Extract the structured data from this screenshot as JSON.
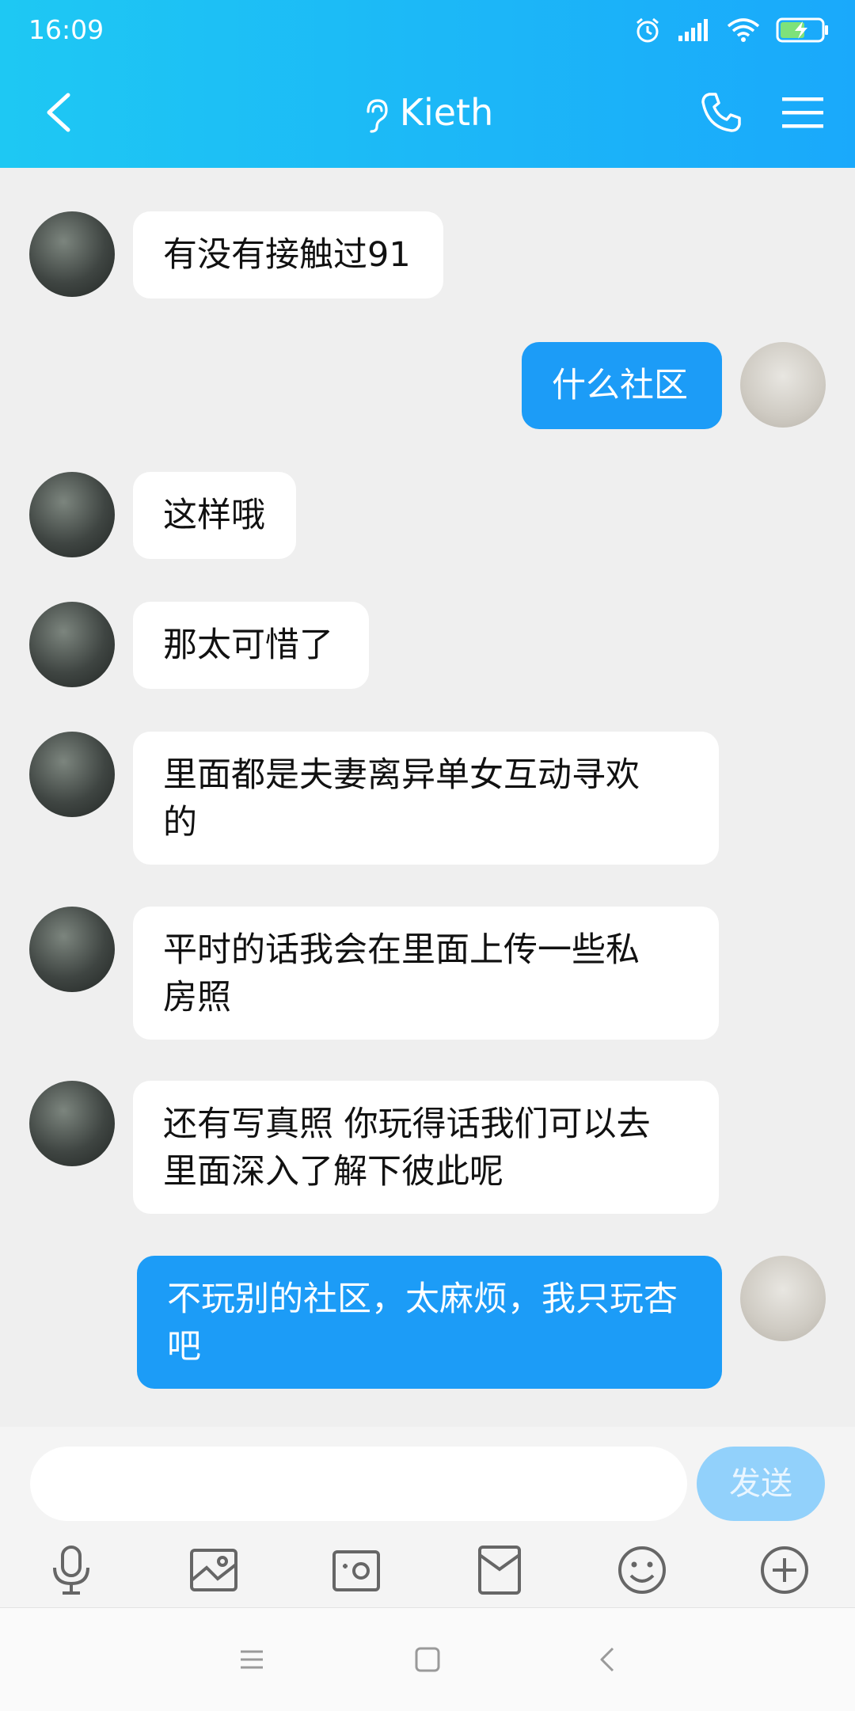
{
  "status_bar": {
    "time": "16:09"
  },
  "header": {
    "title": "Kieth"
  },
  "messages": [
    {
      "side": "in",
      "lines": [
        "有没有接触过91"
      ]
    },
    {
      "side": "out",
      "lines": [
        "什么社区"
      ]
    },
    {
      "side": "in",
      "lines": [
        "这样哦"
      ]
    },
    {
      "side": "in",
      "lines": [
        "那太可惜了"
      ]
    },
    {
      "side": "in",
      "lines": [
        "里面都是夫妻离异单女互动寻欢",
        "的"
      ]
    },
    {
      "side": "in",
      "lines": [
        "平时的话我会在里面上传一些私",
        "房照"
      ]
    },
    {
      "side": "in",
      "lines": [
        "还有写真照  你玩得话我们可以去",
        "里面深入了解下彼此呢"
      ]
    },
    {
      "side": "out",
      "lines": [
        "不玩别的社区，太麻烦，我只玩杏",
        "吧"
      ]
    }
  ],
  "composer": {
    "input_value": "",
    "send_label": "发送"
  },
  "toolbar": {
    "icons": [
      "microphone-icon",
      "image-icon",
      "camera-icon",
      "red-packet-icon",
      "emoji-icon",
      "plus-icon"
    ]
  },
  "colors": {
    "header_start": "#1ec8f3",
    "header_end": "#1aa9fb",
    "outgoing_bubble": "#1c9cf7",
    "send_button": "#92d1fb"
  }
}
